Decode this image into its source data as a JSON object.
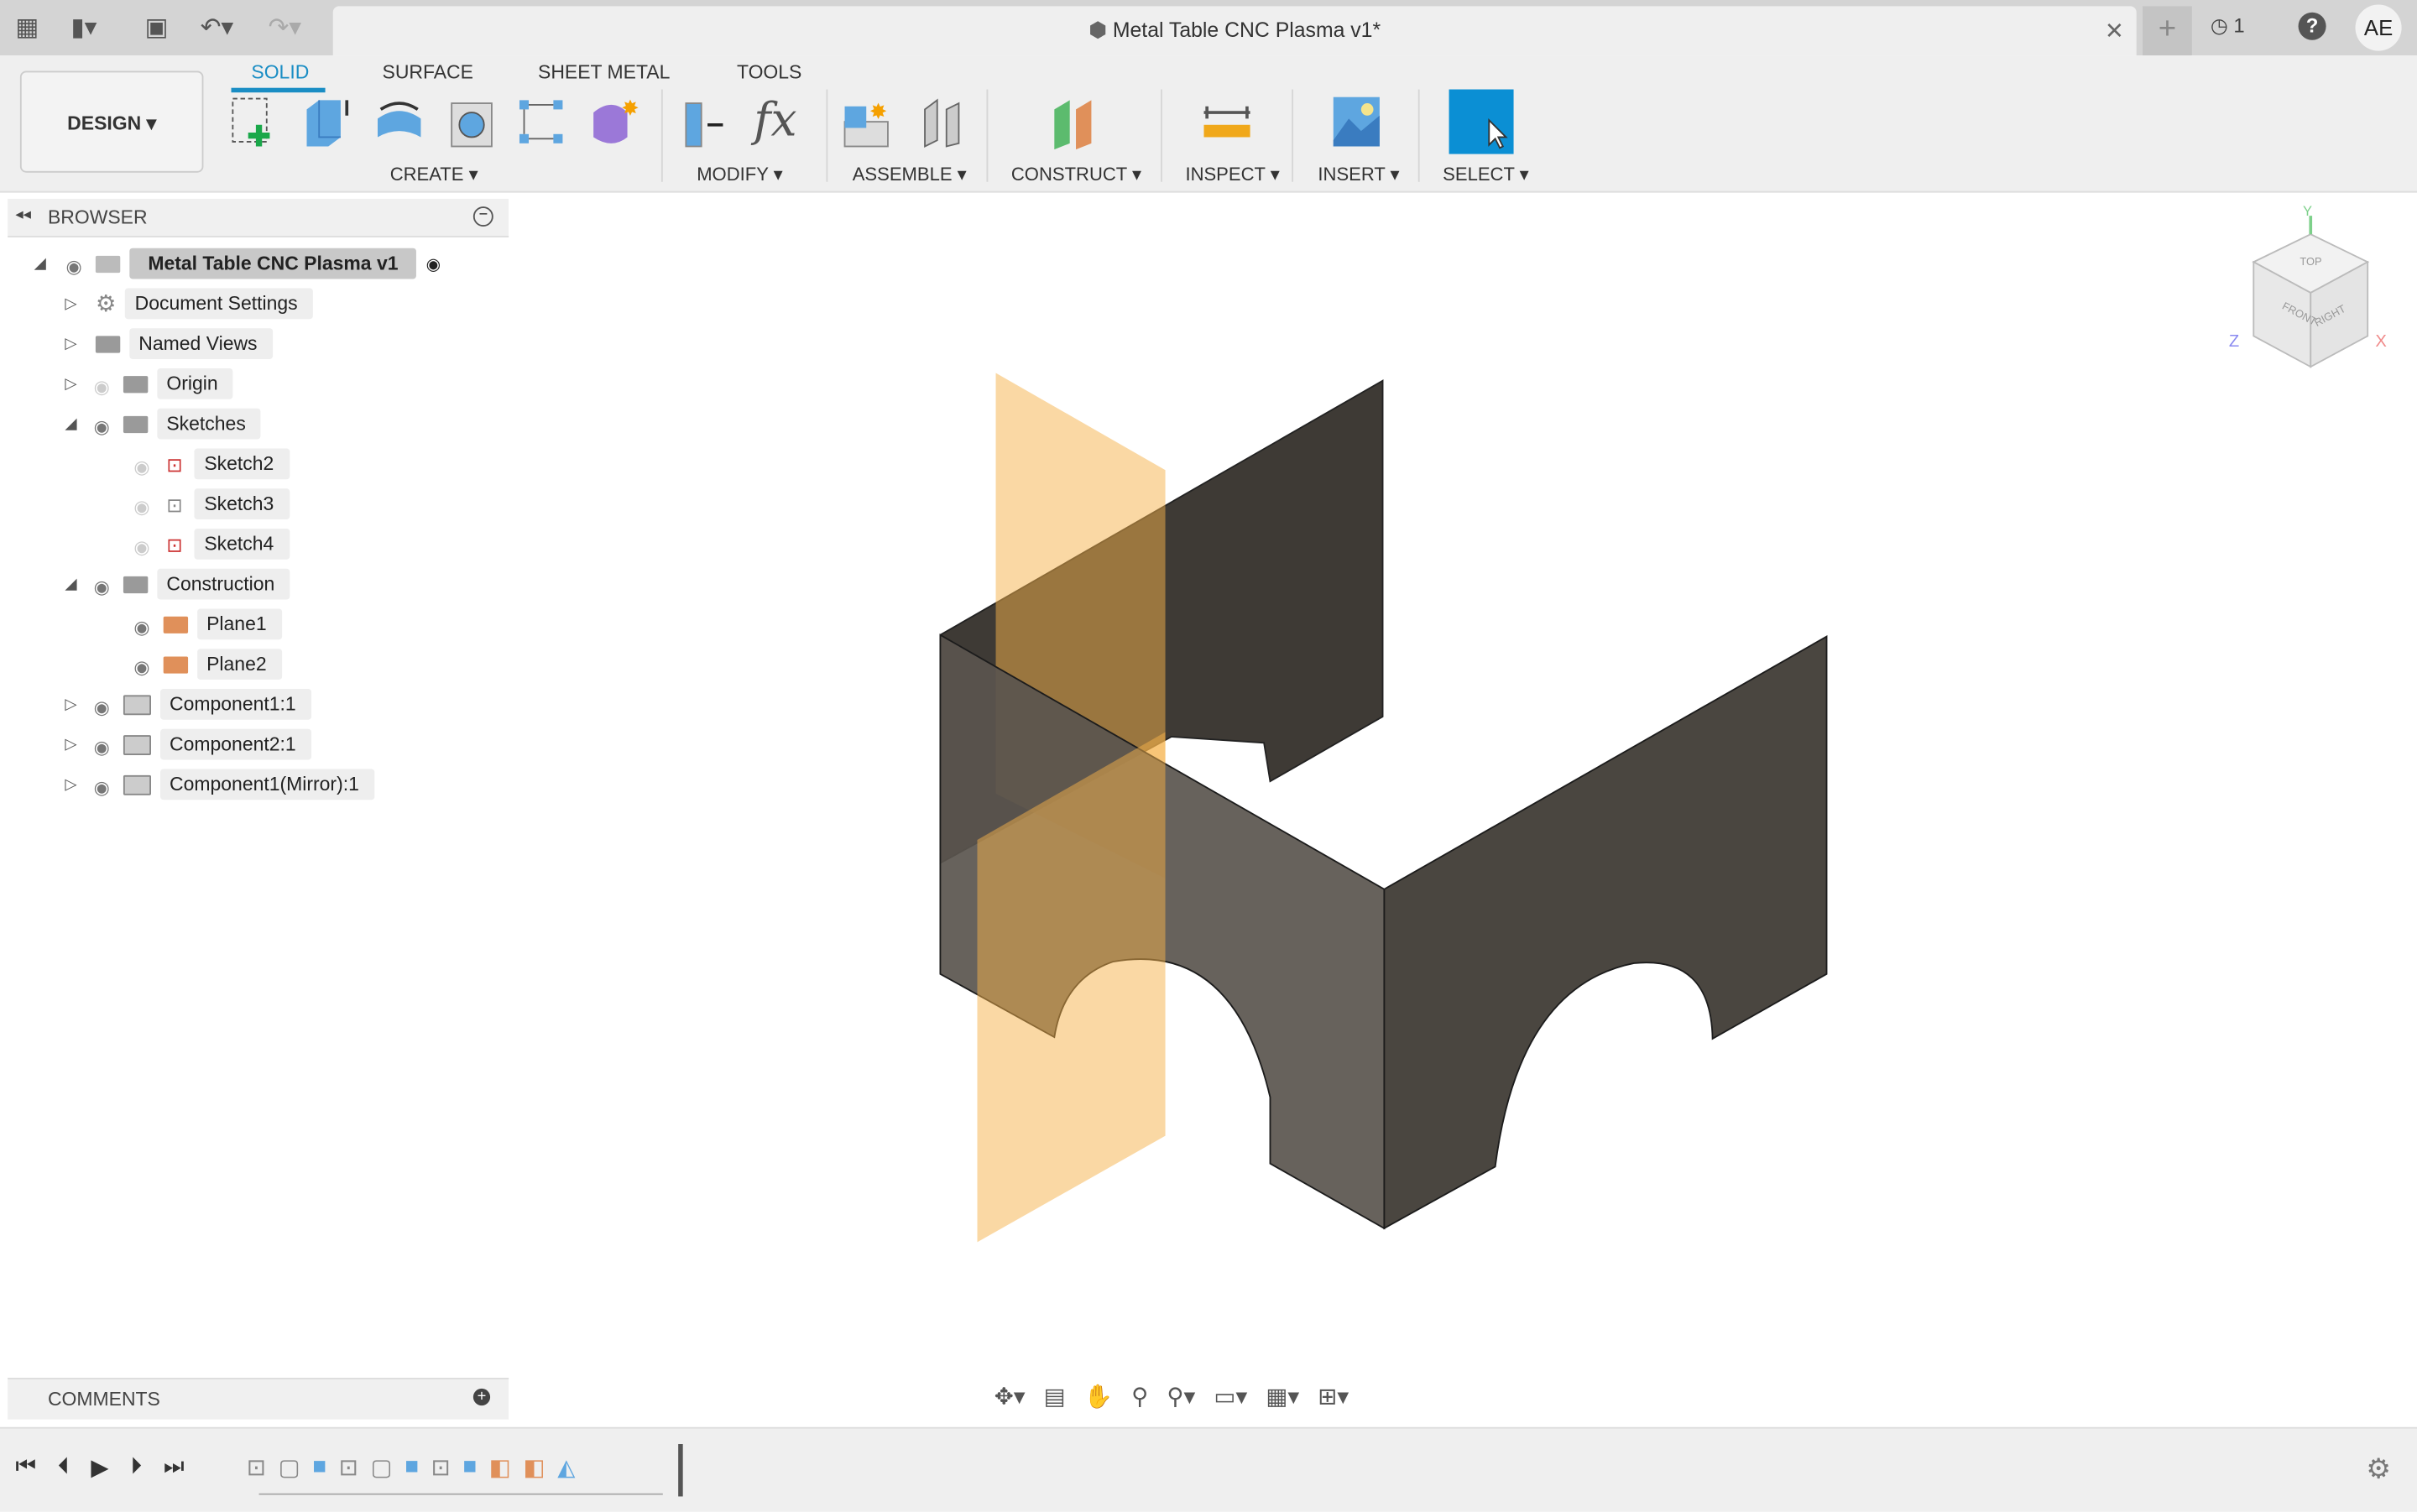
{
  "title_bar": {
    "document_title": "Metal Table CNC Plasma v1*",
    "job_count": "1",
    "user_initials": "AE"
  },
  "ribbon": {
    "workspace": "DESIGN ▾",
    "tabs": [
      {
        "label": "SOLID",
        "active": true
      },
      {
        "label": "SURFACE"
      },
      {
        "label": "SHEET METAL"
      },
      {
        "label": "TOOLS"
      }
    ],
    "groups": [
      {
        "label": "CREATE ▾"
      },
      {
        "label": "MODIFY ▾"
      },
      {
        "label": "ASSEMBLE ▾"
      },
      {
        "label": "CONSTRUCT ▾"
      },
      {
        "label": "INSPECT ▾"
      },
      {
        "label": "INSERT ▾"
      },
      {
        "label": "SELECT ▾"
      }
    ],
    "accent": "#1a8dc4"
  },
  "browser": {
    "header": "BROWSER",
    "root": "Metal Table CNC Plasma v1",
    "items": [
      {
        "label": "Document Settings",
        "icon": "gear-icon"
      },
      {
        "label": "Named Views",
        "icon": "folder-icon"
      },
      {
        "label": "Origin",
        "icon": "folder-icon"
      },
      {
        "label": "Sketches",
        "icon": "folder-icon",
        "expanded": true
      },
      {
        "label": "Sketch2",
        "icon": "sketch-icon"
      },
      {
        "label": "Sketch3",
        "icon": "sketch-icon"
      },
      {
        "label": "Sketch4",
        "icon": "sketch-icon"
      },
      {
        "label": "Construction",
        "icon": "folder-icon",
        "expanded": true
      },
      {
        "label": "Plane1",
        "icon": "plane-icon"
      },
      {
        "label": "Plane2",
        "icon": "plane-icon"
      },
      {
        "label": "Component1:1",
        "icon": "component-icon"
      },
      {
        "label": "Component2:1",
        "icon": "component-icon"
      },
      {
        "label": "Component1(Mirror):1",
        "icon": "component-icon"
      }
    ]
  },
  "viewcube": {
    "top": "TOP",
    "front": "FRONT",
    "right": "RIGHT",
    "x": "X",
    "y": "Y",
    "z": "Z"
  },
  "comments": {
    "label": "COMMENTS"
  },
  "colors": {
    "body": "#4f4a44",
    "plane": "#f5b24a"
  }
}
